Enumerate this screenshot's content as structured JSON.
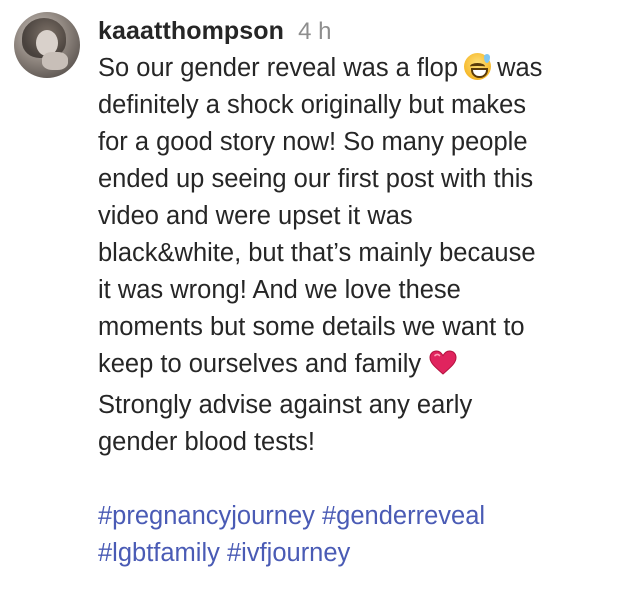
{
  "comment": {
    "username": "kaaatthompson",
    "time": "4 h",
    "lines": [
      {
        "before": "So our gender reveal was a flop",
        "emoji": "grinning-sweat-icon",
        "after": "was"
      },
      {
        "text": "definitely a shock originally but makes"
      },
      {
        "text": "for a good story now! So many people"
      },
      {
        "text": "ended up seeing our first post with this"
      },
      {
        "text": "video and were upset it was"
      },
      {
        "text": "black&white, but that’s mainly because"
      },
      {
        "text": "it was wrong! And we love these"
      },
      {
        "text": "moments but some details we want to"
      },
      {
        "text": "keep to ourselves and family",
        "emoji": "red-heart-icon"
      },
      {
        "text": "Strongly advise against any early"
      },
      {
        "text": "gender blood tests!"
      }
    ],
    "hashtags": {
      "line1": [
        "#pregnancyjourney",
        "#genderreveal"
      ],
      "line2": [
        "#lgbtfamily",
        "#ivfjourney"
      ]
    },
    "colors": {
      "text": "#262626",
      "time": "#8e8e8e",
      "hashtag": "#4a5bb5",
      "heart": "#e0245e"
    }
  }
}
